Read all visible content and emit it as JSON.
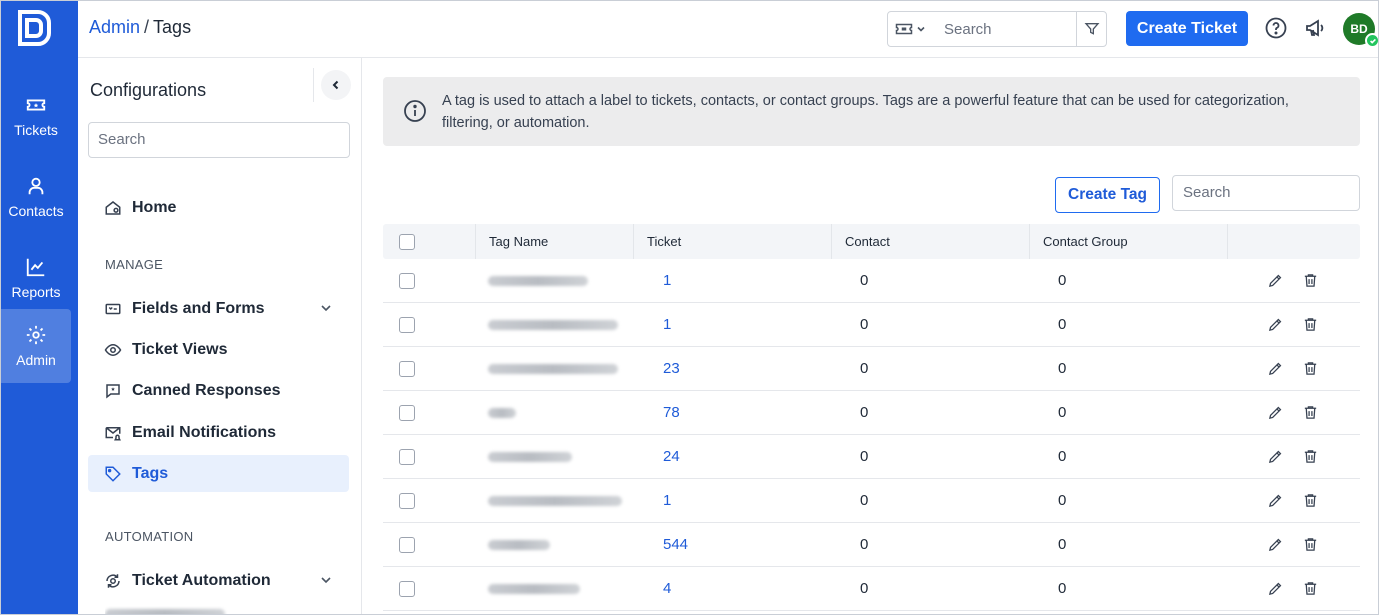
{
  "app": {
    "brand_color": "#1f5bd8",
    "accent": "#1f6bf0"
  },
  "rail": [
    {
      "label": "Tickets",
      "icon": "ticket-icon",
      "active": false
    },
    {
      "label": "Contacts",
      "icon": "user-icon",
      "active": false
    },
    {
      "label": "Reports",
      "icon": "chart-icon",
      "active": false
    },
    {
      "label": "Admin",
      "icon": "gear-icon",
      "active": true
    }
  ],
  "header": {
    "breadcrumb_root": "Admin",
    "breadcrumb_sep": "/",
    "breadcrumb_current": "Tags",
    "search_placeholder": "Search",
    "create_ticket_label": "Create Ticket",
    "avatar_initials": "BD"
  },
  "config": {
    "title": "Configurations",
    "search_placeholder": "Search",
    "home_label": "Home",
    "manage_section": "MANAGE",
    "items": [
      {
        "label": "Fields and Forms",
        "icon": "form-icon",
        "expandable": true
      },
      {
        "label": "Ticket Views",
        "icon": "eye-icon",
        "expandable": false
      },
      {
        "label": "Canned Responses",
        "icon": "message-icon",
        "expandable": false
      },
      {
        "label": "Email Notifications",
        "icon": "mail-bell-icon",
        "expandable": false
      },
      {
        "label": "Tags",
        "icon": "tag-icon",
        "expandable": false,
        "active": true
      }
    ],
    "automation_section": "AUTOMATION",
    "automation_items": [
      {
        "label": "Ticket Automation",
        "icon": "automation-icon",
        "expandable": true
      }
    ]
  },
  "main": {
    "info_text": "A tag is used to attach a label to tickets, contacts, or contact groups. Tags are a powerful feature that can be used for categorization, filtering, or automation.",
    "create_tag_label": "Create Tag",
    "search_placeholder": "Search",
    "columns": [
      "Tag Name",
      "Ticket",
      "Contact",
      "Contact Group"
    ],
    "rows": [
      {
        "ticket": "1",
        "contact": "0",
        "contact_group": "0",
        "name_blur_width": 100
      },
      {
        "ticket": "1",
        "contact": "0",
        "contact_group": "0",
        "name_blur_width": 130
      },
      {
        "ticket": "23",
        "contact": "0",
        "contact_group": "0",
        "name_blur_width": 130
      },
      {
        "ticket": "78",
        "contact": "0",
        "contact_group": "0",
        "name_blur_width": 28
      },
      {
        "ticket": "24",
        "contact": "0",
        "contact_group": "0",
        "name_blur_width": 84
      },
      {
        "ticket": "1",
        "contact": "0",
        "contact_group": "0",
        "name_blur_width": 134
      },
      {
        "ticket": "544",
        "contact": "0",
        "contact_group": "0",
        "name_blur_width": 62
      },
      {
        "ticket": "4",
        "contact": "0",
        "contact_group": "0",
        "name_blur_width": 92
      }
    ]
  }
}
